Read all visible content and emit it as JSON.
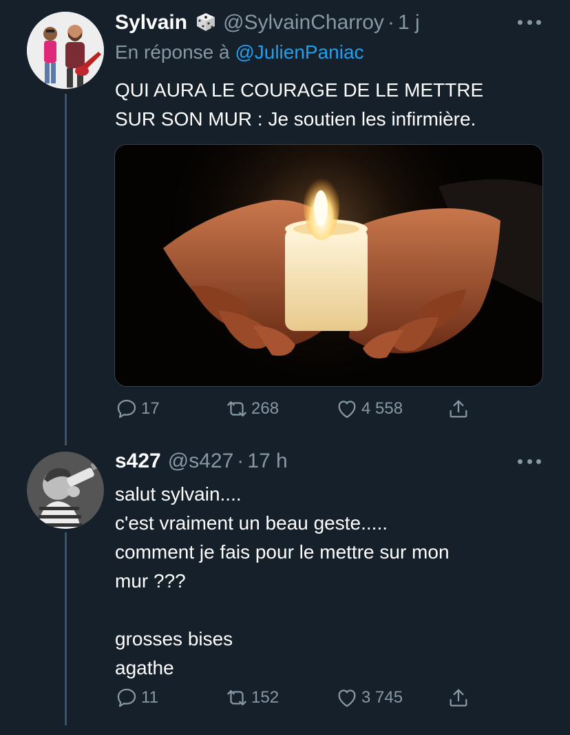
{
  "tweets": [
    {
      "name": "Sylvain",
      "name_icon": "dice-icon",
      "handle": "@SylvainCharroy",
      "separator": "·",
      "time": "1 j",
      "reply_prefix": "En réponse à ",
      "reply_handle": "@JulienPaniac",
      "text": "QUI AURA LE COURAGE DE LE METTRE\nSUR SON MUR : Je soutien les infirmière.",
      "media": "candle-in-hands-photo",
      "stats": {
        "replies": "17",
        "retweets": "268",
        "likes": "4 558"
      }
    },
    {
      "name": "s427",
      "handle": "@s427",
      "separator": "·",
      "time": "17 h",
      "text": "salut sylvain....\nc'est vraiment un beau geste.....\ncomment je fais pour le mettre sur mon\nmur ???\n\ngrosses bises\nagathe",
      "stats": {
        "replies": "11",
        "retweets": "152",
        "likes": "3 745"
      }
    }
  ],
  "colors": {
    "background": "#15202b",
    "secondary_text": "#8899a6",
    "link": "#1da1f2",
    "thread_line": "#3d5466"
  }
}
